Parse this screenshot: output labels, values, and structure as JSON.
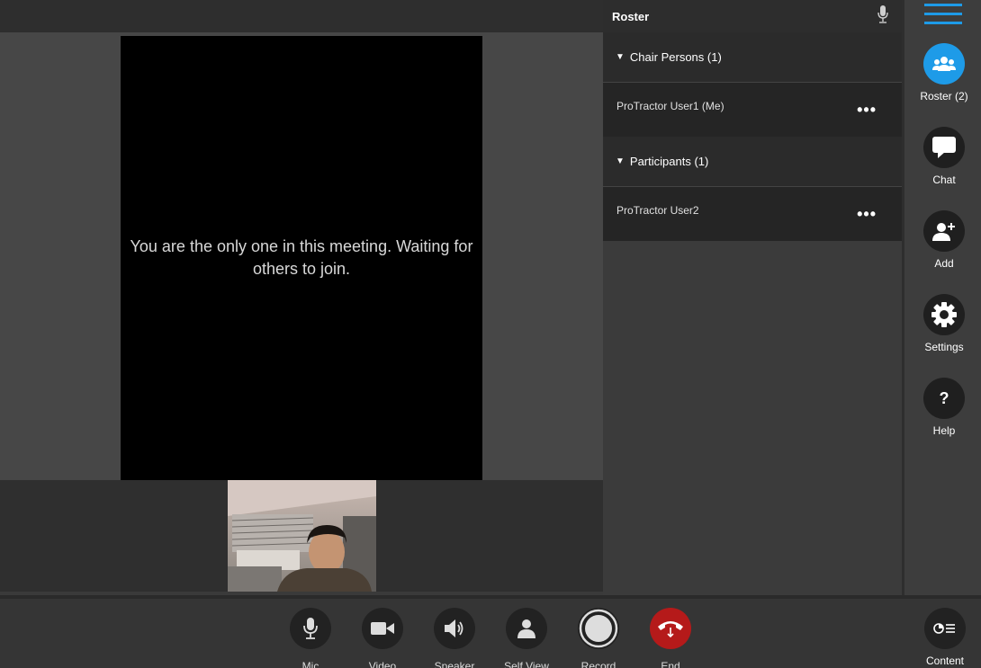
{
  "main": {
    "waiting_message": "You are the only one in this meeting. Waiting for others to join."
  },
  "roster": {
    "title": "Roster",
    "groups": [
      {
        "label": "Chair Persons (1)",
        "members": [
          {
            "name": "ProTractor User1 (Me)",
            "more": "•••"
          }
        ]
      },
      {
        "label": "Participants (1)",
        "members": [
          {
            "name": "ProTractor User2",
            "more": "•••"
          }
        ]
      }
    ]
  },
  "sidebar": {
    "items": [
      {
        "label": "Roster (2)",
        "icon": "roster-icon"
      },
      {
        "label": "Chat",
        "icon": "chat-icon"
      },
      {
        "label": "Add",
        "icon": "add-user-icon"
      },
      {
        "label": "Settings",
        "icon": "gear-icon"
      },
      {
        "label": "Help",
        "icon": "help-icon",
        "glyph": "?"
      }
    ]
  },
  "toolbar": {
    "items": [
      {
        "label": "Mic",
        "icon": "mic-icon"
      },
      {
        "label": "Video",
        "icon": "video-camera-icon"
      },
      {
        "label": "Speaker",
        "icon": "speaker-icon"
      },
      {
        "label": "Self View",
        "icon": "self-view-icon"
      },
      {
        "label": "Record",
        "icon": "record-icon"
      },
      {
        "label": "End",
        "icon": "end-call-icon"
      }
    ],
    "content_label": "Content"
  },
  "colors": {
    "accent": "#1e9be8",
    "end_call": "#b51a1a",
    "panel": "#3b3b3b",
    "row": "#252525"
  }
}
